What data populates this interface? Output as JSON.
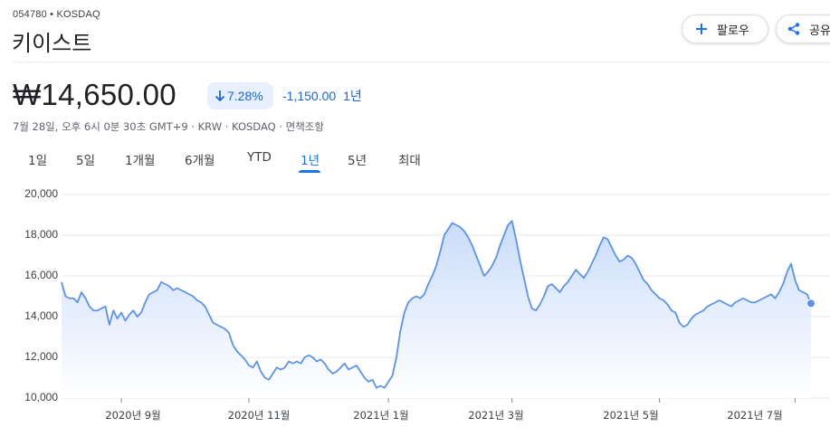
{
  "header": {
    "ticker": "054780 • KOSDAQ",
    "company": "키이스트",
    "follow_label": "팔로우",
    "share_label": "공유"
  },
  "quote": {
    "price": "₩14,650.00",
    "change_percent": "7.28%",
    "change_abs": "-1,150.00",
    "change_period": "1년",
    "meta": "7월 28일, 오후 6시 0분 30초 GMT+9 · KRW · KOSDAQ · 면책조항"
  },
  "tabs": [
    {
      "label": "1일",
      "active": false
    },
    {
      "label": "5일",
      "active": false
    },
    {
      "label": "1개월",
      "active": false
    },
    {
      "label": "6개월",
      "active": false
    },
    {
      "label": "YTD",
      "active": false
    },
    {
      "label": "1년",
      "active": true
    },
    {
      "label": "5년",
      "active": false
    },
    {
      "label": "최대",
      "active": false
    }
  ],
  "colors": {
    "line": "#5b93e8",
    "fill_top": "#c6dafa",
    "fill_bottom": "#ffffff",
    "accent": "#1a73e8",
    "negative": "#1967d2",
    "badge_bg": "#e8f0fe"
  },
  "icons": {
    "follow": "plus-icon",
    "share": "share-icon",
    "change": "arrow-down-icon"
  },
  "chart_data": {
    "type": "area",
    "ylim": [
      10000,
      20000
    ],
    "y_ticks": [
      "20,000",
      "18,000",
      "16,000",
      "14,000",
      "12,000",
      "10,000"
    ],
    "y_tick_values": [
      20000,
      18000,
      16000,
      14000,
      12000,
      10000
    ],
    "x_ticks": [
      "2020년 9월",
      "2020년 11월",
      "2021년 1월",
      "2021년 3월",
      "2021년 5월",
      "2021년 7월"
    ],
    "x_tick_index": [
      15,
      47,
      82,
      113,
      150,
      184
    ],
    "grid": true,
    "series": [
      {
        "values": [
          15700,
          15000,
          14900,
          14900,
          14700,
          15200,
          14900,
          14500,
          14300,
          14300,
          14400,
          14500,
          13600,
          14300,
          13900,
          14200,
          13800,
          14100,
          14300,
          14000,
          14200,
          14700,
          15100,
          15200,
          15300,
          15700,
          15600,
          15500,
          15300,
          15400,
          15300,
          15200,
          15100,
          15000,
          14800,
          14700,
          14500,
          14100,
          13700,
          13600,
          13500,
          13400,
          13200,
          12600,
          12300,
          12100,
          11900,
          11600,
          11500,
          11800,
          11300,
          11000,
          10900,
          11200,
          11500,
          11400,
          11500,
          11800,
          11700,
          11800,
          11700,
          12000,
          12100,
          12000,
          11800,
          11900,
          11700,
          11400,
          11200,
          11300,
          11500,
          11700,
          11400,
          11500,
          11600,
          11300,
          11000,
          10800,
          10900,
          10500,
          10600,
          10500,
          10800,
          11100,
          12000,
          13300,
          14200,
          14700,
          14900,
          15000,
          14900,
          15100,
          15600,
          16000,
          16500,
          17200,
          18000,
          18300,
          18600,
          18500,
          18400,
          18200,
          17900,
          17500,
          17000,
          16500,
          16000,
          16200,
          16500,
          16900,
          17500,
          18000,
          18500,
          18700,
          17800,
          16800,
          15900,
          15000,
          14400,
          14300,
          14600,
          15000,
          15500,
          15600,
          15400,
          15200,
          15500,
          15700,
          16000,
          16300,
          16100,
          15900,
          16200,
          16600,
          17000,
          17500,
          17900,
          17800,
          17400,
          17000,
          16700,
          16800,
          17000,
          16900,
          16600,
          16200,
          15800,
          15600,
          15300,
          15100,
          14900,
          14800,
          14600,
          14300,
          14200,
          13700,
          13500,
          13600,
          13900,
          14100,
          14200,
          14300,
          14500,
          14600,
          14700,
          14800,
          14700,
          14600,
          14500,
          14700,
          14800,
          14900,
          14800,
          14700,
          14700,
          14800,
          14900,
          15000,
          15100,
          14900,
          15200,
          15600,
          16200,
          16600,
          15800,
          15300,
          15200,
          15100,
          14650
        ]
      }
    ]
  }
}
